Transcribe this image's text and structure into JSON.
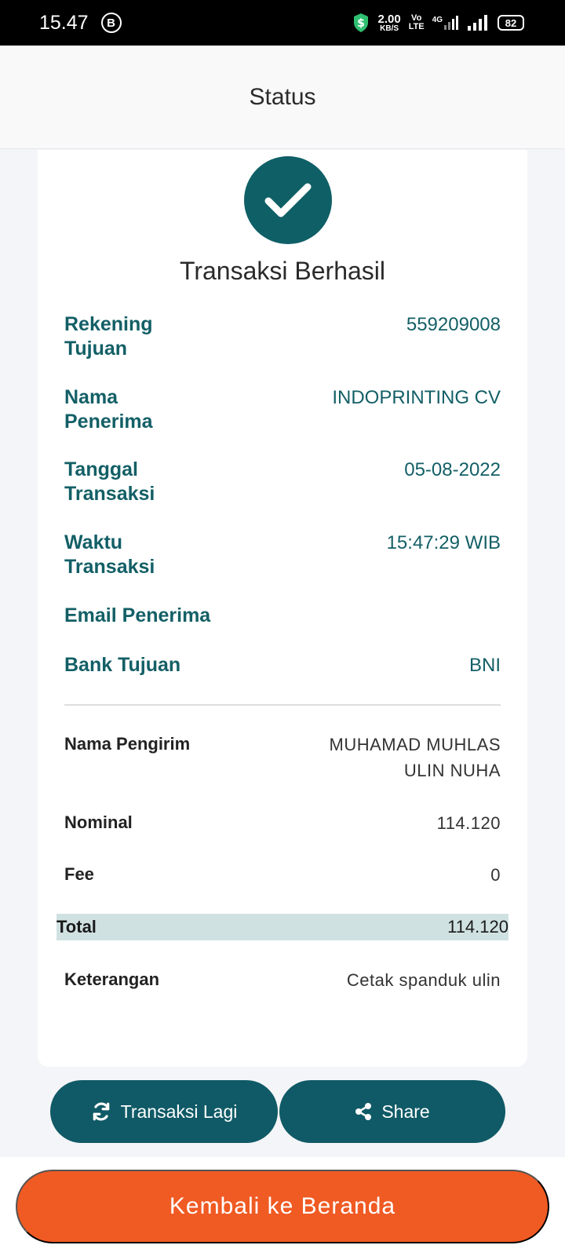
{
  "status_bar": {
    "time": "15.47",
    "b_icon": "B",
    "speed_value": "2.00",
    "speed_unit": "KB/S",
    "volte_top": "Vo",
    "volte_bottom": "LTE",
    "network": "4G",
    "battery": "82"
  },
  "header": {
    "title": "Status"
  },
  "result": {
    "title": "Transaksi Berhasil"
  },
  "recipient": {
    "account_label": "Rekening Tujuan",
    "account_value": "559209008",
    "name_label": "Nama Penerima",
    "name_value": "INDOPRINTING CV",
    "date_label": "Tanggal Transaksi",
    "date_value": "05-08-2022",
    "time_label": "Waktu Transaksi",
    "time_value": "15:47:29 WIB",
    "email_label": "Email Penerima",
    "bank_label": "Bank Tujuan",
    "bank_value": "BNI"
  },
  "sender": {
    "name_label": "Nama Pengirim",
    "name_value_line1": "MUHAMAD MUHLAS",
    "name_value_line2": "ULIN NUHA",
    "nominal_label": "Nominal",
    "nominal_value": "114.120",
    "fee_label": "Fee",
    "fee_value": "0",
    "total_label": "Total",
    "total_value": "114.120",
    "note_label": "Keterangan",
    "note_value": "Cetak spanduk ulin"
  },
  "actions": {
    "repeat_label": "Transaksi Lagi",
    "share_label": "Share",
    "home_label": "Kembali ke Beranda"
  },
  "colors": {
    "primary_teal": "#0f5a66",
    "accent_orange": "#f05a23",
    "total_highlight": "#d0e1e2"
  },
  "icons": {
    "success": "check-icon",
    "repeat": "refresh-icon",
    "share": "share-icon"
  }
}
